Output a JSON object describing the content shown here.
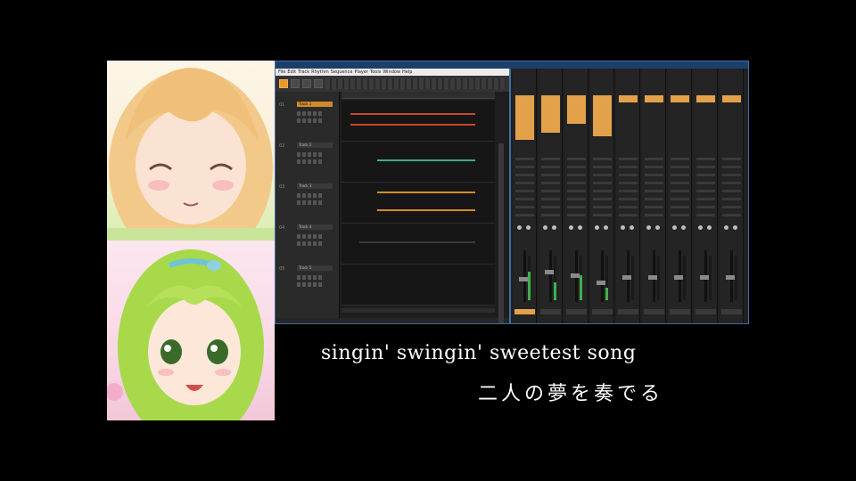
{
  "daw": {
    "menu": [
      "File",
      "Edit",
      "Track",
      "Rhythm",
      "Sequence",
      "Player",
      "Tools",
      "Window",
      "Help"
    ],
    "tracks": [
      {
        "num": "01",
        "name": "Track 1"
      },
      {
        "num": "02",
        "name": "Track 2"
      },
      {
        "num": "03",
        "name": "Track 3"
      },
      {
        "num": "04",
        "name": "Track 4"
      },
      {
        "num": "05",
        "name": "Track 5"
      }
    ],
    "colors": {
      "accent": "#e3a14a",
      "background": "#262626",
      "window_border": "#3f6fa6",
      "clip_red": "#c9472a",
      "clip_green": "#3fae8a",
      "clip_orange": "#d48a2a"
    }
  },
  "lyrics": {
    "line1": "singin' swingin' sweetest song",
    "line2": "二人の夢を奏でる"
  }
}
